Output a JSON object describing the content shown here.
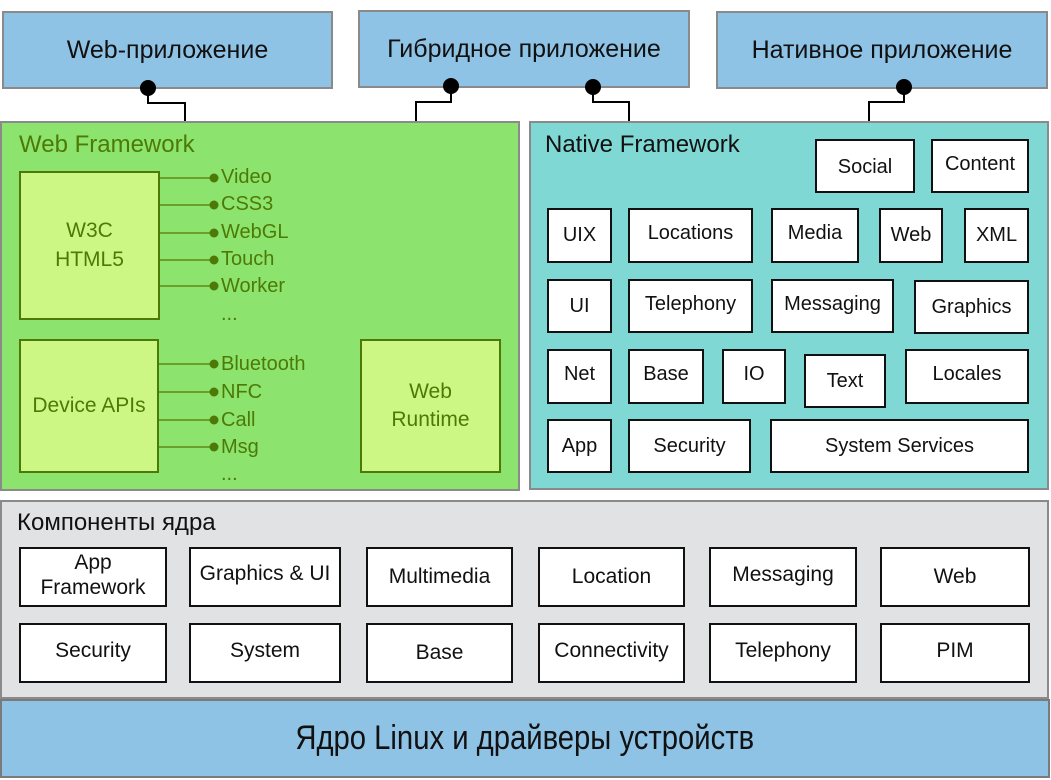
{
  "apps": {
    "web_app": "Web-приложение",
    "hybrid_app": "Гибридное приложение",
    "native_app": "Нативное приложение"
  },
  "web_framework": {
    "title": "Web Framework",
    "w3c_box": [
      "W3C",
      "HTML5"
    ],
    "w3c_items": [
      "Video",
      "CSS3",
      "WebGL",
      "Touch",
      "Worker",
      "..."
    ],
    "device_box": "Device APIs",
    "device_items": [
      "Bluetooth",
      "NFC",
      "Call",
      "Msg",
      "..."
    ],
    "runtime_box": [
      "Web",
      "Runtime"
    ]
  },
  "native_framework": {
    "title": "Native Framework",
    "modules": {
      "social": "Social",
      "content": "Content",
      "uix": "UIX",
      "locations": "Locations",
      "media": "Media",
      "web": "Web",
      "xml": "XML",
      "ui": "UI",
      "telephony": "Telephony",
      "messaging": "Messaging",
      "graphics": "Graphics",
      "net": "Net",
      "base": "Base",
      "io": "IO",
      "text": "Text",
      "locales": "Locales",
      "app": "App",
      "security": "Security",
      "system_services": "System Services"
    }
  },
  "core": {
    "title": "Компоненты ядра",
    "row1": [
      [
        "App",
        "Framework"
      ],
      "Graphics & UI",
      "Multimedia",
      "Location",
      "Messaging",
      "Web"
    ],
    "row2": [
      "Security",
      "System",
      "Base",
      "Connectivity",
      "Telephony",
      "PIM"
    ]
  },
  "linux": {
    "label": "Ядро Linux и драйверы устройств"
  },
  "colors": {
    "app_blue": "#8fc3e6",
    "web_green": "#8ce36e",
    "web_box_green": "#ccf784",
    "web_text_green": "#4d7a06",
    "native_teal": "#7fd8d3",
    "core_gray": "#e1e2e4"
  }
}
